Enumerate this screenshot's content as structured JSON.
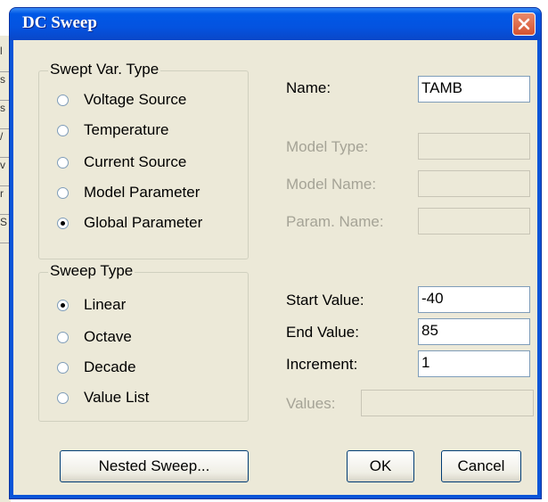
{
  "window": {
    "title": "DC Sweep"
  },
  "swept_var": {
    "legend": "Swept Var. Type",
    "options": [
      {
        "label": "Voltage Source",
        "selected": false
      },
      {
        "label": "Temperature",
        "selected": false
      },
      {
        "label": "Current Source",
        "selected": false
      },
      {
        "label": "Model Parameter",
        "selected": false
      },
      {
        "label": "Global Parameter",
        "selected": true
      }
    ]
  },
  "sweep_type": {
    "legend": "Sweep Type",
    "options": [
      {
        "label": "Linear",
        "selected": true
      },
      {
        "label": "Octave",
        "selected": false
      },
      {
        "label": "Decade",
        "selected": false
      },
      {
        "label": "Value List",
        "selected": false
      }
    ]
  },
  "fields": {
    "name": {
      "label": "Name:",
      "value": "TAMB"
    },
    "model_type": {
      "label": "Model Type:",
      "value": ""
    },
    "model_name": {
      "label": "Model Name:",
      "value": ""
    },
    "param_name": {
      "label": "Param. Name:",
      "value": ""
    },
    "start_value": {
      "label": "Start Value:",
      "value": "-40"
    },
    "end_value": {
      "label": "End Value:",
      "value": "85"
    },
    "increment": {
      "label": "Increment:",
      "value": "1"
    },
    "values": {
      "label": "Values:",
      "value": ""
    }
  },
  "buttons": {
    "nested": "Nested Sweep...",
    "ok": "OK",
    "cancel": "Cancel"
  },
  "background_fragments": [
    "l",
    "s",
    "s",
    "/",
    "v",
    "r",
    "S"
  ]
}
